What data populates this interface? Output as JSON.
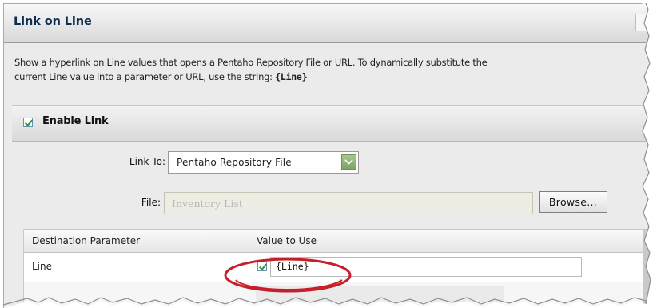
{
  "panel": {
    "title": "Link on Line",
    "description_line_1": "Show a hyperlink on Line values that opens a Pentaho Repository File or URL. To dynamically substitute the",
    "description_line_2": "current Line value into a parameter or URL, use the string: ",
    "description_token": "{Line}"
  },
  "enable_link": {
    "label": "Enable Link",
    "checked": true
  },
  "link_to": {
    "label": "Link To:",
    "selected": "Pentaho Repository File"
  },
  "file": {
    "label": "File:",
    "value": "Inventory List",
    "browse_label": "Browse..."
  },
  "parameters_table": {
    "columns": [
      "Destination Parameter",
      "Value to Use"
    ],
    "rows": [
      {
        "parameter": "Line",
        "use_value": true,
        "value": "{Line}"
      }
    ]
  },
  "colors": {
    "accent_green": "#88ad72",
    "highlight_red": "#c61f2a",
    "title_blue": "#0f2d52"
  }
}
